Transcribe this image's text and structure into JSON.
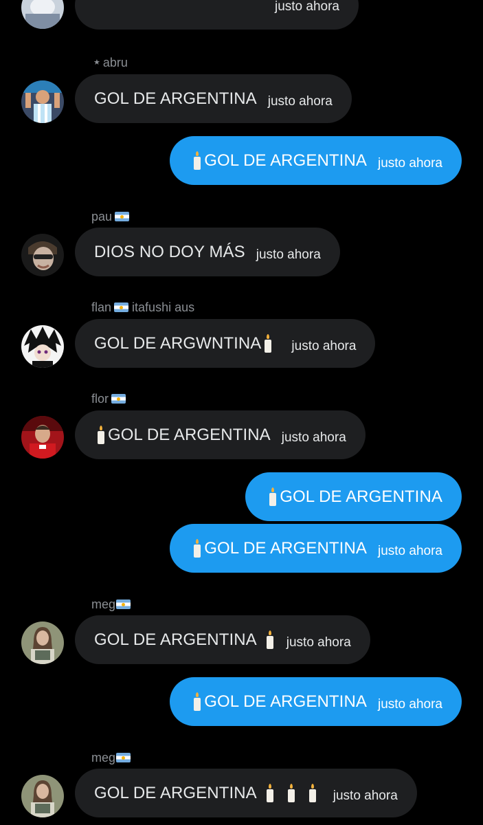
{
  "messages": [
    {
      "kind": "in",
      "text": "",
      "time": "justo ahora"
    },
    {
      "kind": "in",
      "sender": "abru",
      "text": "GOL DE ARGENTINA",
      "time": "justo ahora"
    },
    {
      "kind": "out",
      "text": "GOL DE ARGENTINA",
      "time": "justo ahora"
    },
    {
      "kind": "in",
      "sender": "pau",
      "text": "DIOS NO DOY MÁS",
      "time": "justo ahora"
    },
    {
      "kind": "in",
      "sender": "flan",
      "sender_suffix": "itafushi aus",
      "text": "GOL DE ARGWNTINA",
      "time": "justo ahora"
    },
    {
      "kind": "in",
      "sender": "flor",
      "text": "GOL DE ARGENTINA",
      "time": "justo ahora"
    },
    {
      "kind": "out",
      "text": "GOL DE ARGENTINA",
      "time": ""
    },
    {
      "kind": "out",
      "text": "GOL DE ARGENTINA",
      "time": "justo ahora"
    },
    {
      "kind": "in",
      "sender": "meg",
      "text": "GOL DE ARGENTINA",
      "time": "justo ahora"
    },
    {
      "kind": "out",
      "text": "GOL DE ARGENTINA",
      "time": "justo ahora"
    },
    {
      "kind": "in",
      "sender": "meg",
      "text": "GOL DE ARGENTINA",
      "time": "justo ahora"
    }
  ],
  "icons": {
    "candle": "candle-emoji-icon",
    "flag": "argentina-flag-emoji-icon",
    "star": "star-icon"
  },
  "colors": {
    "background": "#000000",
    "incoming_bubble": "#1e1f21",
    "outgoing_bubble": "#1d9bf0",
    "sender_name": "#8b8f94"
  }
}
